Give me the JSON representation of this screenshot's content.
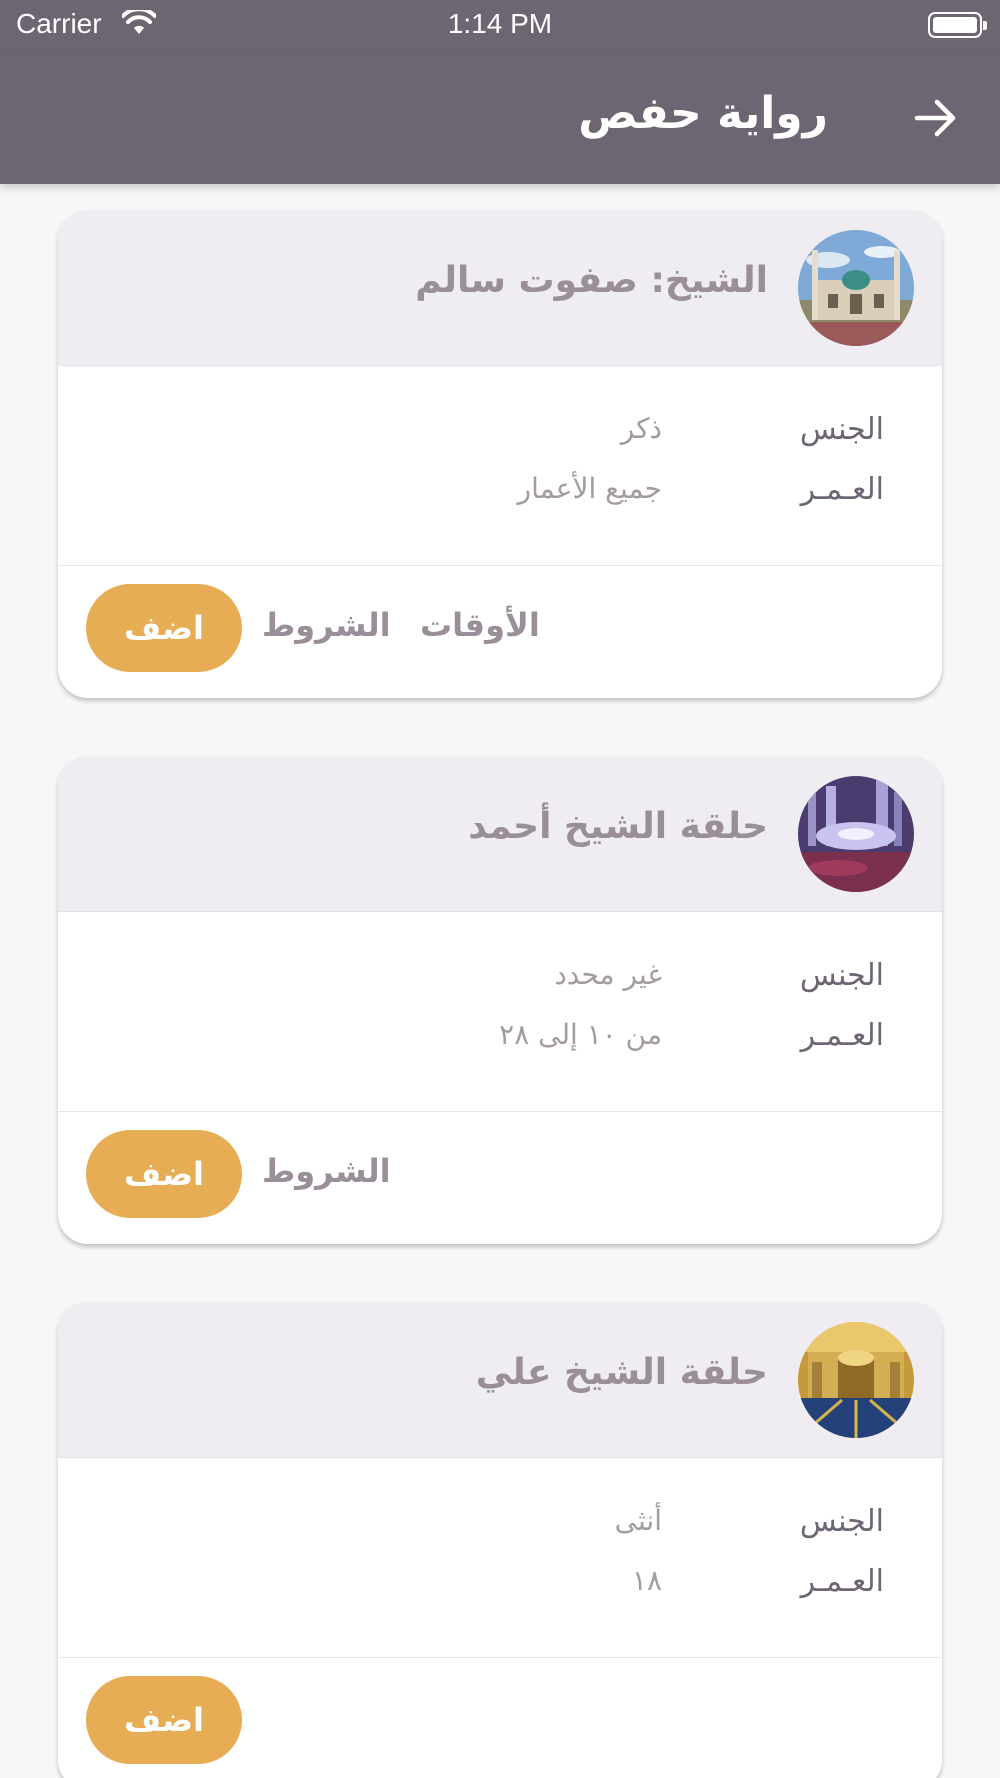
{
  "status_bar": {
    "carrier": "Carrier",
    "time": "1:14 PM"
  },
  "header": {
    "title": "رواية حفص",
    "back_icon": "arrow-right-icon"
  },
  "labels": {
    "gender": "الجنس",
    "age": "العـمـر",
    "add": "اضف",
    "conditions": "الشروط",
    "times": "الأوقات"
  },
  "cards": [
    {
      "title": "الشيخ: صفوت سالم",
      "gender": "ذكر",
      "age": "جميع الأعمار",
      "avatar": "mosque-exterior",
      "show_conditions": true,
      "show_times": true
    },
    {
      "title": "حلقة الشيخ أحمد",
      "gender": "غير محدد",
      "age": "من ١٠ إلى ٢٨",
      "avatar": "fantasy-city",
      "show_conditions": true,
      "show_times": false
    },
    {
      "title": "حلقة الشيخ علي",
      "gender": "أنثى",
      "age": "١٨",
      "avatar": "mosque-interior",
      "show_conditions": false,
      "show_times": false
    }
  ],
  "colors": {
    "header": "#6e6572",
    "accent": "#e6ad55",
    "card_head": "#efedf1"
  }
}
